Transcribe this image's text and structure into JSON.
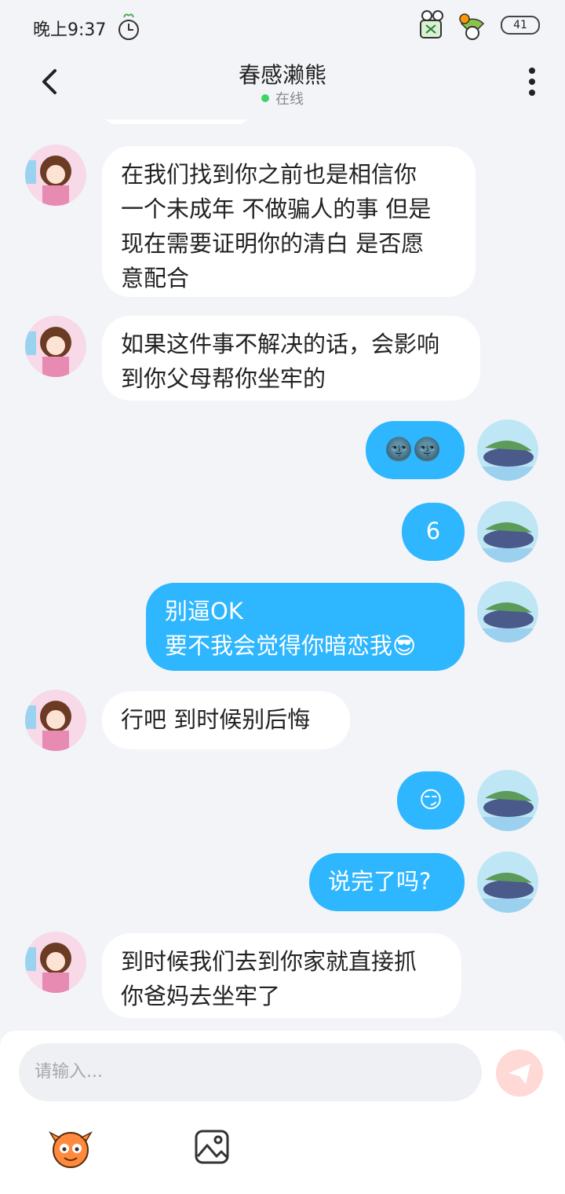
{
  "status_bar": {
    "time": "晚上9:37",
    "battery": "41"
  },
  "header": {
    "title": "春感濑熊",
    "status": "在线"
  },
  "messages": [
    {
      "side": "in",
      "lines": [
        "在我们找到你之前也是相信你",
        "一个未成年 不做骗人的事 但是",
        "现在需要证明你的清白 是否愿",
        "意配合"
      ]
    },
    {
      "side": "in",
      "lines": [
        "如果这件事不解决的话，会影响",
        "到你父母帮你坐牢的"
      ]
    },
    {
      "side": "out",
      "text": "🌚🌚"
    },
    {
      "side": "out",
      "text": "6"
    },
    {
      "side": "out",
      "lines": [
        "别逼OK",
        "要不我会觉得你暗恋我😎"
      ]
    },
    {
      "side": "in",
      "text": "行吧 到时候别后悔"
    },
    {
      "side": "out",
      "text": "😏"
    },
    {
      "side": "out",
      "text": "说完了吗?"
    },
    {
      "side": "in",
      "lines": [
        "到时候我们去到你家就直接抓",
        "你爸妈去坐牢了"
      ]
    }
  ],
  "input": {
    "placeholder": "请输入..."
  },
  "colors": {
    "outgoing_bubble": "#2eb6ff",
    "incoming_bubble": "#ffffff",
    "background": "#f2f4f7",
    "send_button": "#ffd9d6"
  }
}
